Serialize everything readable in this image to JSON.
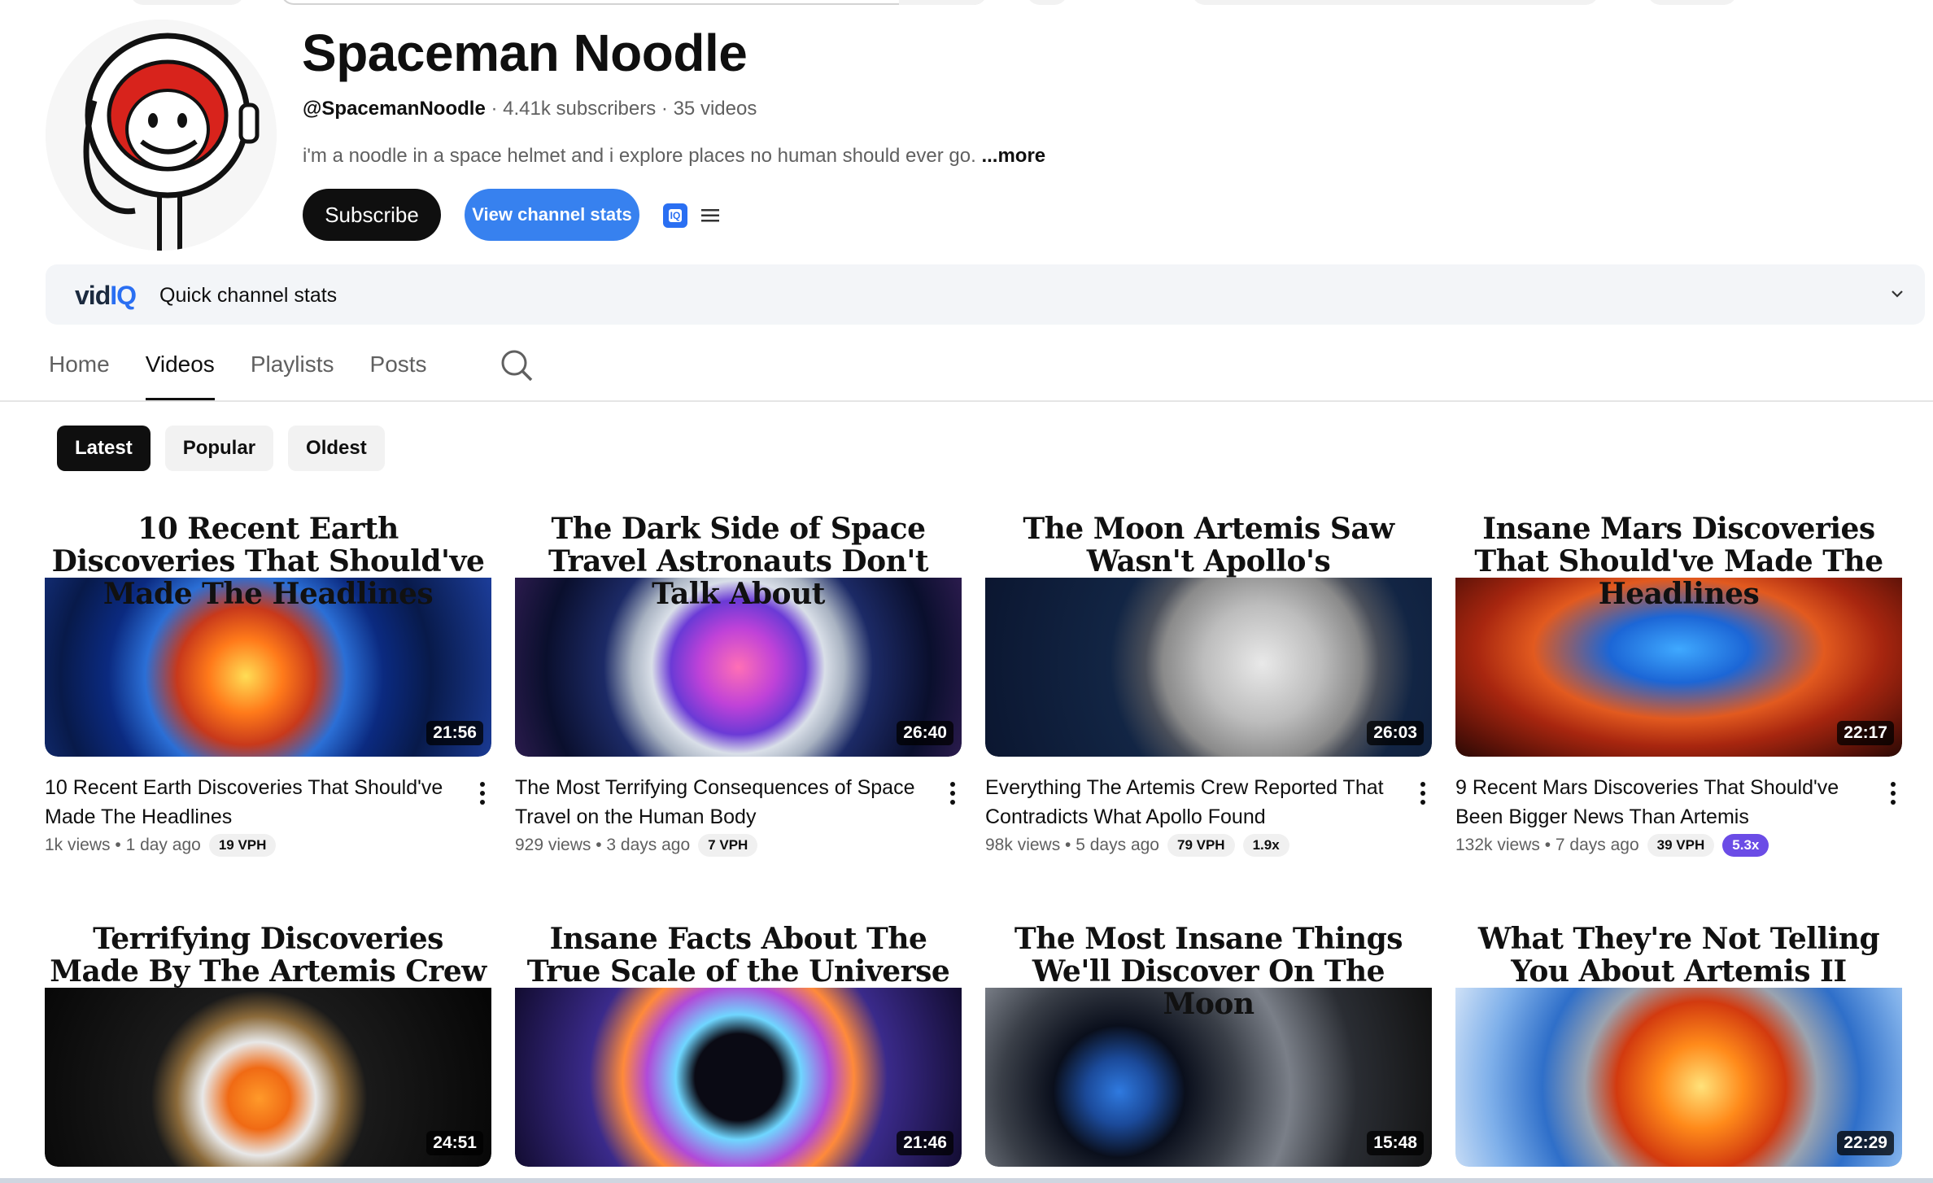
{
  "channel": {
    "name": "Spaceman Noodle",
    "handle": "@SpacemanNoodle",
    "subscribers": "4.41k subscribers",
    "videos": "35 videos",
    "description": "i'm a noodle in a space helmet and i explore places no human should ever go.",
    "more_label": "...more",
    "subscribe_label": "Subscribe",
    "stats_label": "View channel stats"
  },
  "vidiq": {
    "logo_a": "vid",
    "logo_b": "IQ",
    "label": "Quick channel stats",
    "badge": "IQ"
  },
  "tabs": [
    {
      "label": "Home",
      "active": false
    },
    {
      "label": "Videos",
      "active": true
    },
    {
      "label": "Playlists",
      "active": false
    },
    {
      "label": "Posts",
      "active": false
    }
  ],
  "chips": [
    {
      "label": "Latest",
      "active": true
    },
    {
      "label": "Popular",
      "active": false
    },
    {
      "label": "Oldest",
      "active": false
    }
  ],
  "videos": [
    {
      "thumb_title": "10 Recent Earth Discoveries That Should've Made The Headlines",
      "duration": "21:56",
      "title": "10 Recent Earth Discoveries That Should've Made The Headlines",
      "views": "1k views",
      "age": "1 day ago",
      "vph": "19 VPH",
      "multiplier": "",
      "art": "earth"
    },
    {
      "thumb_title": "The Dark Side of Space Travel Astronauts Don't Talk About",
      "duration": "26:40",
      "title": "The Most Terrifying Consequences of Space Travel on the Human Body",
      "views": "929 views",
      "age": "3 days ago",
      "vph": "7 VPH",
      "multiplier": "",
      "art": "brain"
    },
    {
      "thumb_title": "The Moon Artemis Saw Wasn't Apollo's",
      "duration": "26:03",
      "title": "Everything The Artemis Crew Reported That Contradicts What Apollo Found",
      "views": "98k views",
      "age": "5 days ago",
      "vph": "79 VPH",
      "multiplier": "1.9x",
      "art": "moon"
    },
    {
      "thumb_title": "Insane Mars Discoveries That Should've Made The Headlines",
      "duration": "22:17",
      "title": "9 Recent Mars Discoveries That Should've Been Bigger News Than Artemis",
      "views": "132k views",
      "age": "7 days ago",
      "vph": "39 VPH",
      "multiplier": "5.3x",
      "art": "mars"
    },
    {
      "thumb_title": "Terrifying Discoveries Made By The Artemis Crew",
      "duration": "24:51",
      "title": "",
      "views": "",
      "age": "",
      "vph": "",
      "multiplier": "",
      "art": "helmet"
    },
    {
      "thumb_title": "Insane Facts About The True Scale of the Universe",
      "duration": "21:46",
      "title": "",
      "views": "",
      "age": "",
      "vph": "",
      "multiplier": "",
      "art": "web"
    },
    {
      "thumb_title": "The Most Insane Things We'll Discover On The Moon",
      "duration": "15:48",
      "title": "",
      "views": "",
      "age": "",
      "vph": "",
      "multiplier": "",
      "art": "cave"
    },
    {
      "thumb_title": "What They're Not Telling You About Artemis II",
      "duration": "22:29",
      "title": "",
      "views": "",
      "age": "",
      "vph": "",
      "multiplier": "",
      "art": "capsule"
    }
  ],
  "colors": {
    "accent_blue": "#3781ef",
    "vidiq_blue": "#2a6ff2",
    "multiplier_purple": "#6b4ce6",
    "text_primary": "#0f0f0f",
    "text_secondary": "#606060"
  },
  "icons": [
    "search-icon",
    "menu-icon",
    "chevron-down-icon",
    "more-vert-icon"
  ]
}
